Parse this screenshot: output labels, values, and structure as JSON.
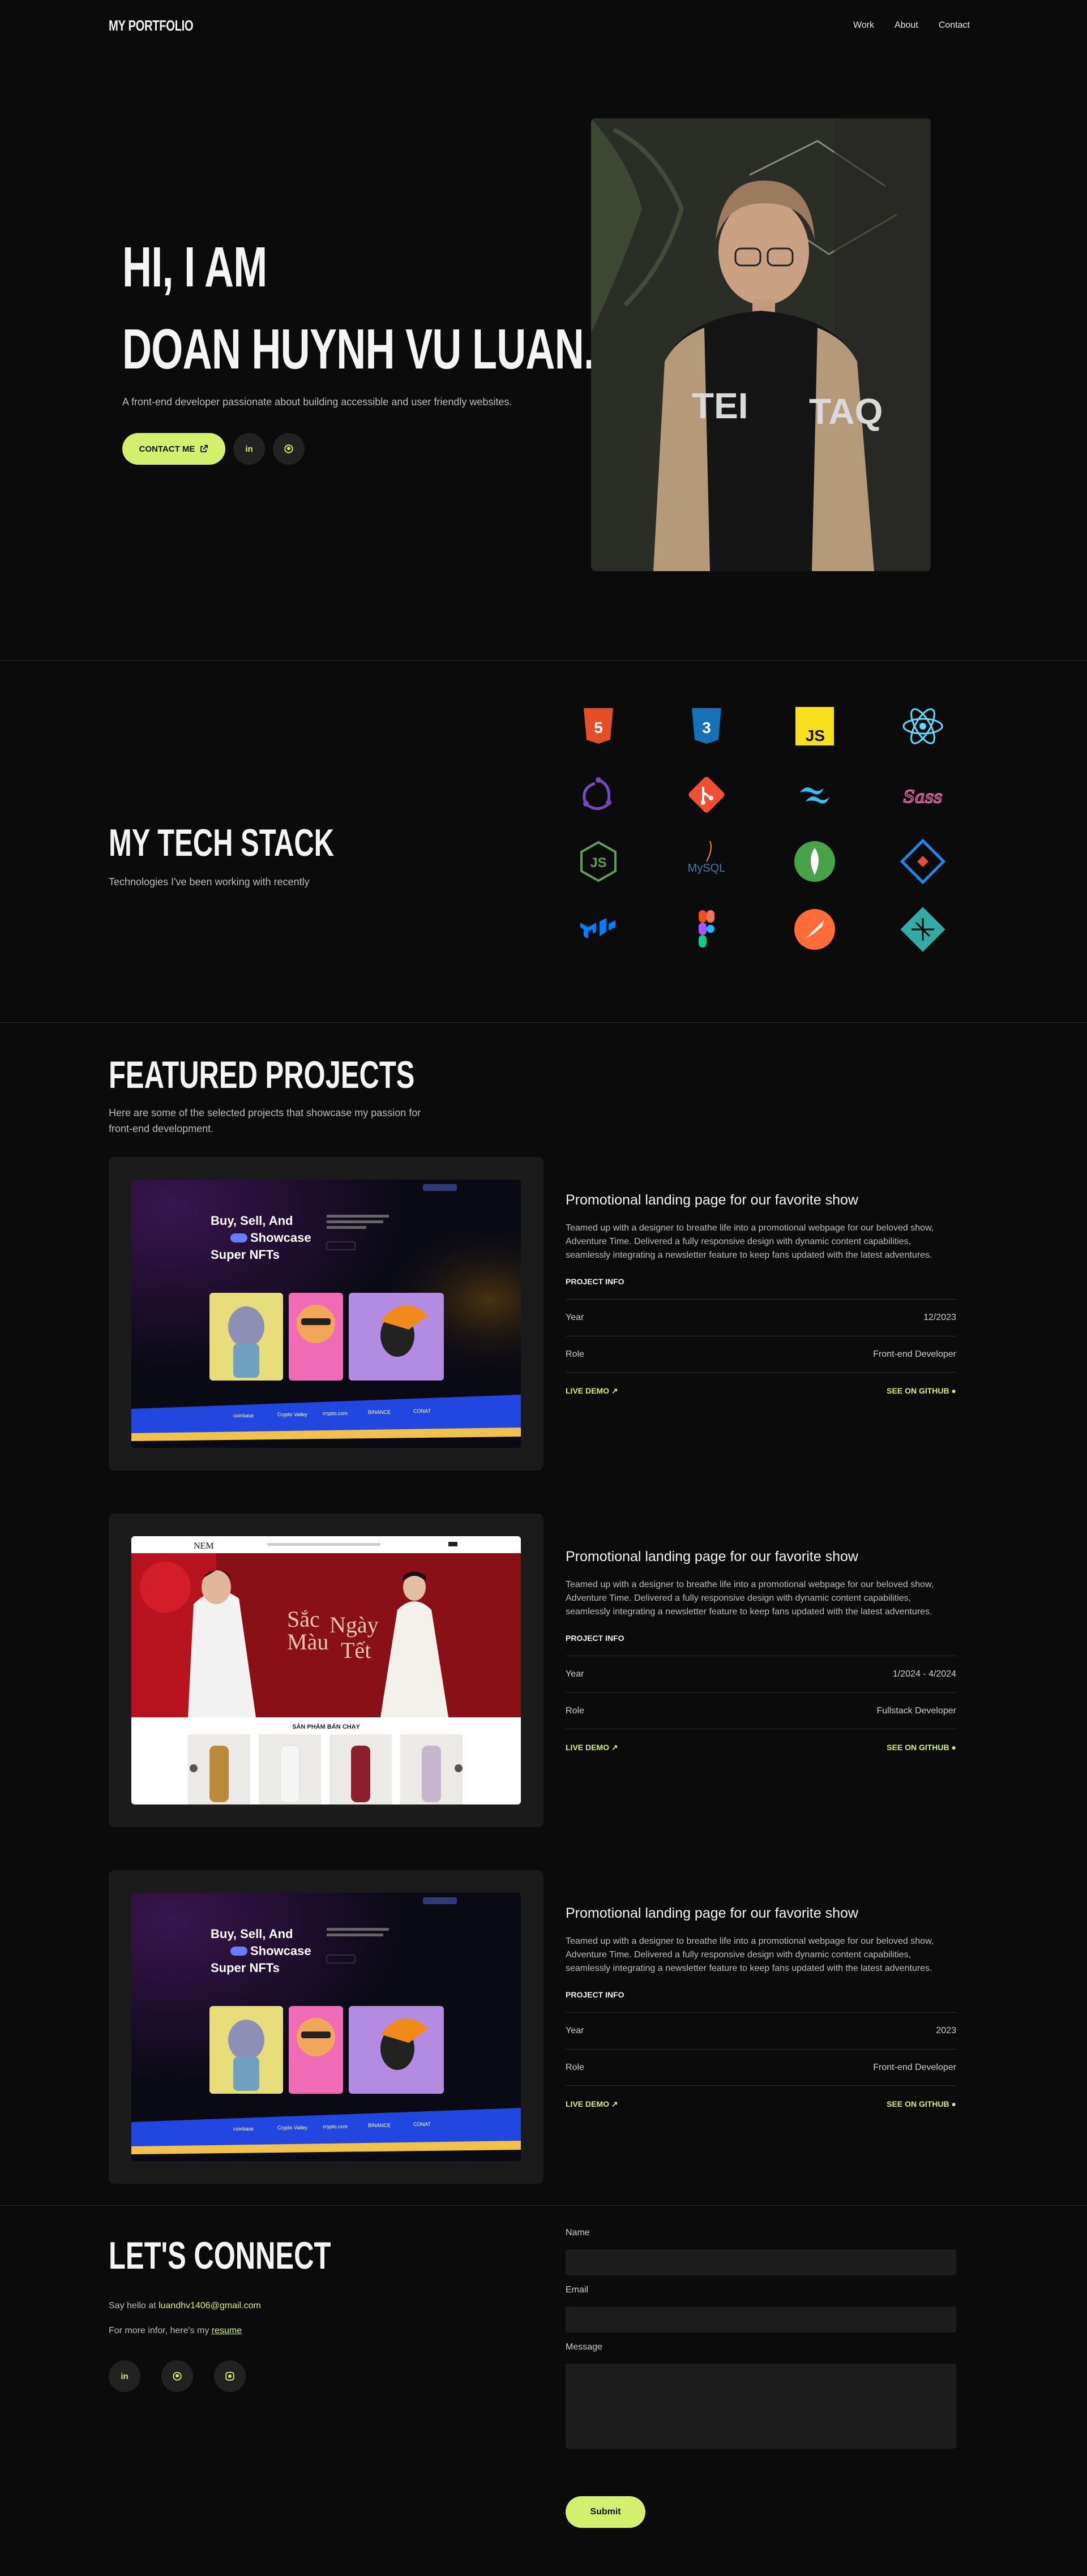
{
  "header": {
    "logo": "MY PORTFOLIO",
    "nav": [
      "Work",
      "About",
      "Contact"
    ]
  },
  "hero": {
    "line1": "HI, I AM",
    "line2": "DOAN HUYNH VU LUAN.",
    "tagline": "A front-end developer passionate about building accessible and user friendly websites.",
    "contact_label": "CONTACT ME",
    "linkedin_label": "in",
    "github_label": "",
    "photo_print": "TAQ"
  },
  "tech": {
    "title": "MY TECH STACK",
    "subtitle": "Technologies I've been working with recently",
    "icons": [
      {
        "name": "html5-icon",
        "color": "#e34f26"
      },
      {
        "name": "css3-icon",
        "color": "#1572b6"
      },
      {
        "name": "javascript-icon",
        "color": "#f7df1e",
        "text": "JS"
      },
      {
        "name": "react-icon",
        "color": "#61dafb"
      },
      {
        "name": "redux-icon",
        "color": "#764abc"
      },
      {
        "name": "git-icon",
        "color": "#f05032"
      },
      {
        "name": "tailwind-icon",
        "color": "#38bdf8"
      },
      {
        "name": "sass-icon",
        "color": "#cc6699",
        "text": "Sass"
      },
      {
        "name": "nodejs-icon",
        "color": "#5fa04e",
        "text": "JS"
      },
      {
        "name": "mysql-icon",
        "color": "#4479a1",
        "text": "MySQL"
      },
      {
        "name": "mongodb-icon",
        "color": "#47a248"
      },
      {
        "name": "codesandbox-icon",
        "color": "#1e88e5"
      },
      {
        "name": "mui-icon",
        "color": "#007fff"
      },
      {
        "name": "figma-icon",
        "color": "#f24e1e"
      },
      {
        "name": "postman-icon",
        "color": "#ff6c37"
      },
      {
        "name": "netlify-icon",
        "color": "#35a9a3"
      }
    ]
  },
  "projects": {
    "title": "FEATURED PROJECTS",
    "subtitle1": "Here are some of the selected projects that showcase my passion for",
    "subtitle2": "front-end development.",
    "info_heading": "PROJECT INFO",
    "year_label": "Year",
    "role_label": "Role",
    "live_demo": "LIVE DEMO",
    "see_github": "SEE ON GITHUB",
    "items": [
      {
        "title": "Promotional landing page for our favorite show",
        "desc": "Teamed up with a designer to breathe life into a promotional webpage for our beloved show, Adventure Time. Delivered a fully responsive design with dynamic content capabilities, seamlessly integrating a newsletter feature to keep fans updated with the latest adventures.",
        "year": "12/2023",
        "role": "Front-end Developer"
      },
      {
        "title": "Promotional landing page for our favorite show",
        "desc": "Teamed up with a designer to breathe life into a promotional webpage for our beloved show, Adventure Time. Delivered a fully responsive design with dynamic content capabilities, seamlessly integrating a newsletter feature to keep fans updated with the latest adventures.",
        "year": "1/2024 - 4/2024",
        "role": "Fullstack Developer"
      },
      {
        "title": "Promotional landing page for our favorite show",
        "desc": "Teamed up with a designer to breathe life into a promotional webpage for our beloved show, Adventure Time. Delivered a fully responsive design with dynamic content capabilities, seamlessly integrating a newsletter feature to keep fans updated with the latest adventures.",
        "year": "2023",
        "role": "Front-end Developer"
      }
    ],
    "nft": {
      "h1": "Buy, Sell, And",
      "h2": "Showcase",
      "h3": "Super NFTs",
      "brands": [
        "coinbase",
        "Crypto Valley",
        "crypto.com",
        "BINANCE",
        "CONAT"
      ]
    },
    "fashion": {
      "logo": "NEM",
      "banner1": "Sắc",
      "banner2": "Màu",
      "banner3": "Ngày",
      "banner4": "Tết",
      "section": "SẢN PHẨM BÁN CHẠY"
    }
  },
  "connect": {
    "title": "LET'S CONNECT",
    "hello_prefix": "Say hello at ",
    "email": "luandhv1406@gmail.com",
    "more_prefix": "For more infor, here's my ",
    "resume": "resume",
    "social": [
      "in",
      "",
      ""
    ],
    "name_label": "Name",
    "email_label": "Email",
    "message_label": "Message",
    "submit": "Submit"
  }
}
